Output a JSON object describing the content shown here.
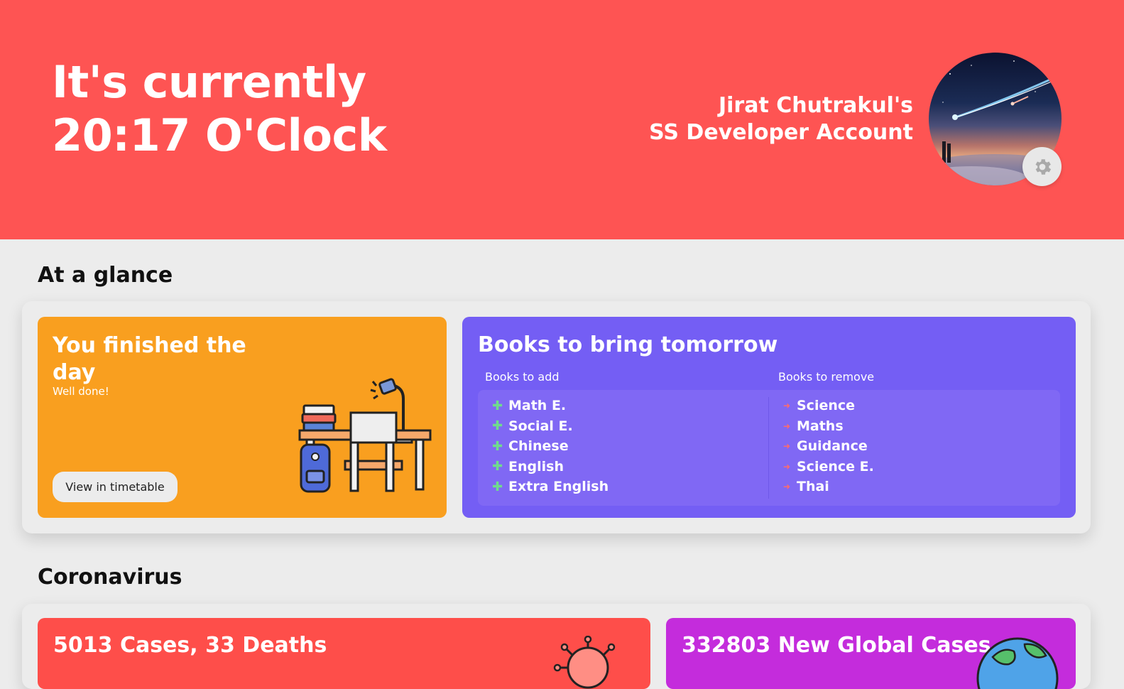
{
  "header": {
    "clock_line1": "It's currently",
    "clock_line2": "20:17 O'Clock",
    "account_name": "Jirat Chutrakul's",
    "account_type": "SS Developer Account",
    "avatar_alt": "avatar",
    "settings_icon": "gear-icon"
  },
  "glance": {
    "title": "At a glance",
    "day_card": {
      "title": "You finished the day",
      "subtitle": "Well done!",
      "button_label": "View in timetable",
      "illustration": "desk-illustration",
      "bg_color": "#f99f1f"
    },
    "books_card": {
      "title": "Books to bring tomorrow",
      "add_heading": "Books to add",
      "remove_heading": "Books to remove",
      "add": [
        "Math E.",
        "Social E.",
        "Chinese",
        "English",
        "Extra English"
      ],
      "remove": [
        "Science",
        "Maths",
        "Guidance",
        "Science E.",
        "Thai"
      ],
      "bg_color": "#745ef4"
    }
  },
  "coronavirus": {
    "title": "Coronavirus",
    "local_card": {
      "title": "5013 Cases, 33 Deaths",
      "icon": "virus-icon",
      "bg_color": "#fe4e4a"
    },
    "global_card": {
      "title": "332803 New Global Cases",
      "icon": "globe-icon",
      "bg_color": "#c42cdc"
    }
  }
}
